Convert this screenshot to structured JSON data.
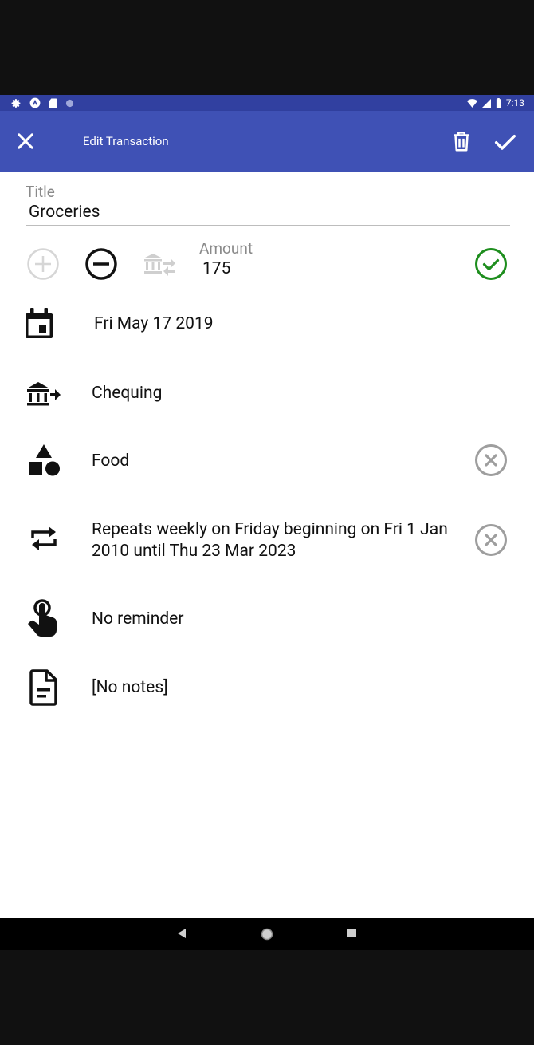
{
  "status_bar": {
    "time": "7:13"
  },
  "app_bar": {
    "title": "Edit Transaction"
  },
  "title_field": {
    "label": "Title",
    "value": "Groceries"
  },
  "amount_field": {
    "label": "Amount",
    "value": "175"
  },
  "date": {
    "value": "Fri May 17 2019"
  },
  "account": {
    "value": "Chequing"
  },
  "category": {
    "value": "Food"
  },
  "repeat": {
    "value": "Repeats weekly on Friday beginning on Fri 1 Jan 2010 until Thu 23 Mar 2023"
  },
  "reminder": {
    "value": "No reminder"
  },
  "notes": {
    "value": "[No notes]"
  },
  "colors": {
    "app_bar": "#3f51b5",
    "status_bar": "#3140a0",
    "confirm_green": "#1e8e1e",
    "clear_gray": "#9e9e9e"
  },
  "icons": {
    "close": "close-icon",
    "delete": "trash-icon",
    "save": "check-icon",
    "income": "plus-circle-icon",
    "expense": "minus-circle-icon",
    "transfer": "bank-transfer-icon",
    "date": "calendar-icon",
    "account": "bank-out-icon",
    "category": "shapes-icon",
    "repeat": "repeat-icon",
    "reminder": "touch-icon",
    "notes": "file-document-icon"
  }
}
